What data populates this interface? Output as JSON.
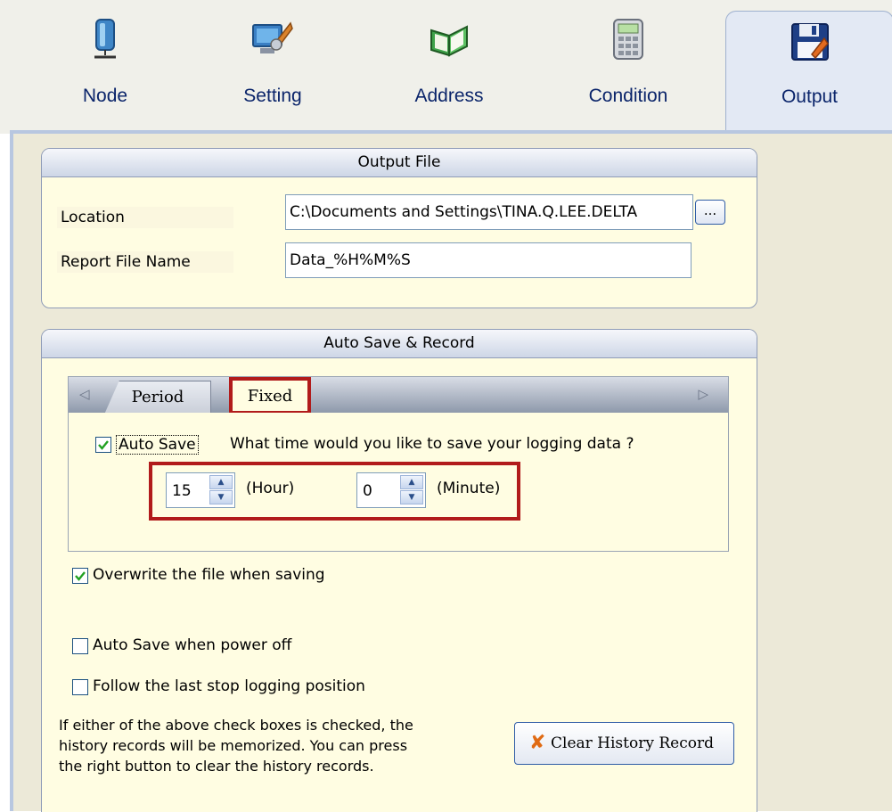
{
  "tabs": [
    {
      "label": "Node",
      "icon": "server-node-icon"
    },
    {
      "label": "Setting",
      "icon": "computer-wrench-icon"
    },
    {
      "label": "Address",
      "icon": "open-book-icon"
    },
    {
      "label": "Condition",
      "icon": "calculator-icon"
    },
    {
      "label": "Output",
      "icon": "floppy-disk-icon",
      "active": true
    }
  ],
  "output_file": {
    "title": "Output File",
    "location_label": "Location",
    "location_value": "C:\\Documents and Settings\\TINA.Q.LEE.DELTA",
    "browse_label": "...",
    "report_label": "Report File Name",
    "report_value": "Data_%H%M%S"
  },
  "auto_save": {
    "title": "Auto Save & Record",
    "tabs": [
      "Period",
      "Fixed"
    ],
    "active_tab": "Fixed",
    "auto_save_label": "Auto Save",
    "auto_save_checked": true,
    "question": "What time would you like to save your logging data ?",
    "hour_value": "15",
    "hour_unit": "(Hour)",
    "minute_value": "0",
    "minute_unit": "(Minute)",
    "overwrite_label": "Overwrite the file when saving",
    "overwrite_checked": true,
    "power_off_label": "Auto Save when power off",
    "power_off_checked": false,
    "follow_label": "Follow the last stop logging position",
    "follow_checked": false,
    "note_lines": [
      "If either of the above check boxes is checked, the",
      "history records will be memorized. You can press",
      "the right button to clear the history records."
    ],
    "clear_button": "Clear History Record"
  },
  "colors": {
    "highlight": "#b11b1b",
    "group_bg": "#fffde2",
    "tab_label": "#0a246a"
  }
}
